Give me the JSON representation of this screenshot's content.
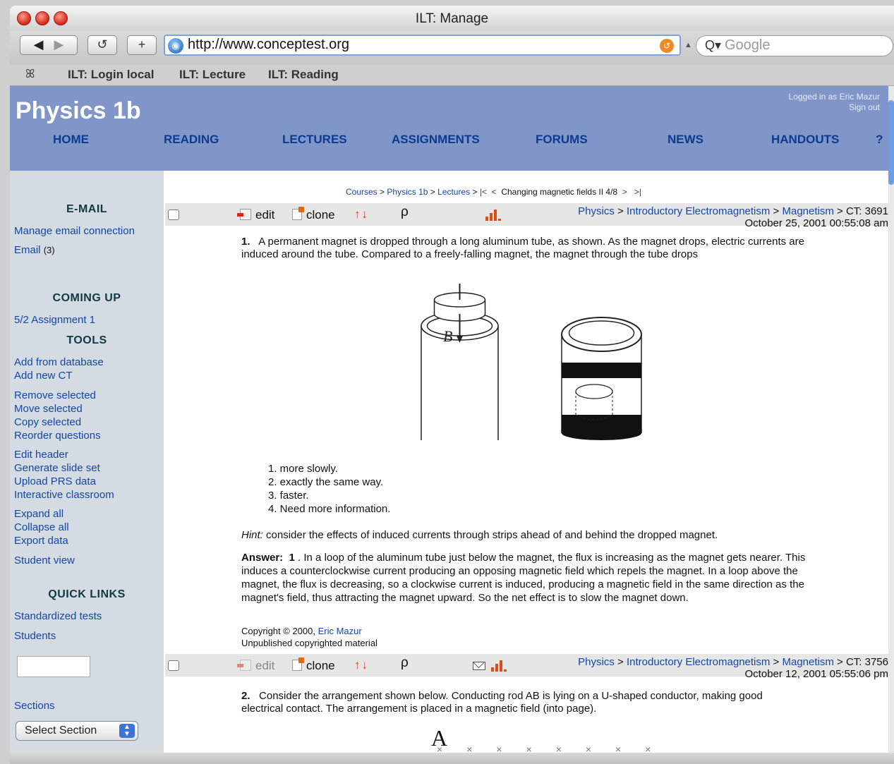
{
  "window": {
    "title": "ILT: Manage"
  },
  "toolbar": {
    "back": "◀",
    "forward": "▶",
    "reload": "↺",
    "new_tab": "+",
    "url": "http://www.conceptest.org",
    "search_placeholder": "Google"
  },
  "bookmarks": {
    "icon": "ꕤ",
    "items": [
      "ILT: Login local",
      "ILT: Lecture",
      "ILT: Reading"
    ]
  },
  "header": {
    "course_title": "Physics 1b",
    "logged_in": "Logged in as Eric Mazur",
    "sign_out": "Sign out",
    "nav": [
      "HOME",
      "READING",
      "LECTURES",
      "ASSIGNMENTS",
      "FORUMS",
      "NEWS",
      "HANDOUTS",
      "?"
    ]
  },
  "sidebar": {
    "email_heading": "E-MAIL",
    "manage_email": "Manage email connection",
    "email": "Email",
    "email_count": "(3)",
    "coming_up_heading": "COMING UP",
    "assignment": "5/2 Assignment 1",
    "tools_heading": "TOOLS",
    "tools": [
      "Add from database",
      "Add new CT",
      "Remove selected",
      "Move selected",
      "Copy selected",
      "Reorder questions",
      "Edit header",
      "Generate slide set",
      "Upload PRS data",
      "Interactive classroom",
      "Expand all",
      "Collapse all",
      "Export data",
      "Student view"
    ],
    "quick_links_heading": "QUICK LINKS",
    "quick_links": [
      "Standardized tests",
      "Students"
    ],
    "sections": "Sections",
    "select_section": "Select Section"
  },
  "breadcrumb": {
    "courses": "Courses",
    "sep": ">",
    "course": "Physics 1b",
    "lectures": "Lectures",
    "first": "|<",
    "prev": "<",
    "current": "Changing magnetic fields II 4/8",
    "next": ">",
    "last": ">|"
  },
  "question1": {
    "edit": "edit",
    "clone": "clone",
    "arrows": "↑↓",
    "zoom": "ρ",
    "subject": "Physics",
    "topic": "Introductory Electromagnetism",
    "subtopic": "Magnetism",
    "ct": "> CT: 3691",
    "date": "October 25, 2001  00:55:08 am",
    "number": "1.",
    "text": "A permanent magnet is dropped through a long aluminum tube, as shown. As the magnet drops, electric currents are induced around the tube. Compared to a freely-falling magnet, the magnet through the tube drops",
    "figure_label": "B",
    "choices": [
      "1.  more slowly.",
      "2.  exactly the same way.",
      "3.  faster.",
      "4.  Need more information."
    ],
    "hint_label": "Hint:",
    "hint": " consider the effects of induced currents through strips ahead of and behind the dropped magnet.",
    "answer_label": "Answer:",
    "answer_value": "1",
    "answer_text": " .   In a loop of the aluminum tube just below the magnet, the flux is increasing as the magnet gets nearer. This induces a counterclockwise current producing an opposing magnetic field which repels the magnet. In a loop above the magnet, the flux is decreasing, so a clockwise current is induced, producing a magnetic field in the same direction as the magnet's field, thus attracting the magnet upward. So the net effect is to slow the magnet down.",
    "copyright": "Copyright © 2000, ",
    "author": "Eric Mazur",
    "unpublished": "Unpublished copyrighted material"
  },
  "question2": {
    "edit": "edit",
    "clone": "clone",
    "arrows": "↑↓",
    "zoom": "ρ",
    "subject": "Physics",
    "topic": "Introductory Electromagnetism",
    "subtopic": "Magnetism",
    "ct": "> CT: 3756",
    "date": "October 12, 2001  05:55:06 pm",
    "number": "2.",
    "text": "Consider the arrangement shown below. Conducting rod AB is lying on a U-shaped conductor, making good electrical contact. The arrangement is placed in a magnetic field (into page).",
    "figure_label": "A",
    "field_marks": "××××××××"
  },
  "colors": {
    "banner": "#8196c8",
    "nav_link": "#0b3b8f",
    "link": "#1247a8",
    "sidebar": "#d5dbe2",
    "accent": "#e8361a"
  }
}
